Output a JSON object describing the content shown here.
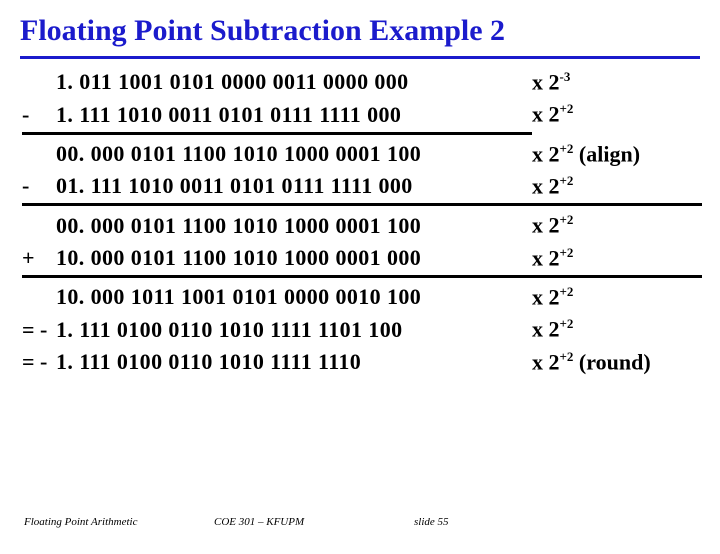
{
  "title": "Floating Point Subtraction Example 2",
  "rows": [
    {
      "sign": "",
      "mant": "1. 011 1001 0101 0000 0011 0000  000",
      "expo_html": "x 2<sup>-3</sup>"
    },
    {
      "sign": "-",
      "mant": "1. 111 1010 0011 0101 0111 1111   000",
      "expo_html": "x 2<sup>+2</sup>"
    },
    {
      "sign": "",
      "mant": "00. 000 0101 1100 1010 1000 0001 100",
      "expo_html": "x 2<sup>+2</sup> (align)"
    },
    {
      "sign": "-",
      "mant": "01. 111 1010 0011 0101 0111 1111 000",
      "expo_html": "x 2<sup>+2</sup>"
    },
    {
      "sign": "",
      "mant": "00. 000 0101 1100 1010 1000 0001 100",
      "expo_html": "x 2<sup>+2</sup>"
    },
    {
      "sign": "+",
      "mant": "10. 000 0101 1100 1010 1000 0001 000",
      "expo_html": "x 2<sup>+2</sup>"
    },
    {
      "sign": "",
      "mant": "10. 000 1011 1001 0101 0000 0010 100",
      "expo_html": "x 2<sup>+2</sup>"
    },
    {
      "sign": "= -",
      "mant": " 1. 111 0100 0110 1010 1111 1101 100",
      "expo_html": "x 2<sup>+2</sup>"
    },
    {
      "sign": "= -",
      "mant": " 1. 111 0100 0110 1010 1111 1110",
      "expo_html": "x 2<sup>+2</sup> (round)"
    }
  ],
  "rules_after": [
    1,
    3,
    5
  ],
  "footer": {
    "left": "Floating Point Arithmetic",
    "mid": "COE 301 – KFUPM",
    "right": "slide 55"
  }
}
